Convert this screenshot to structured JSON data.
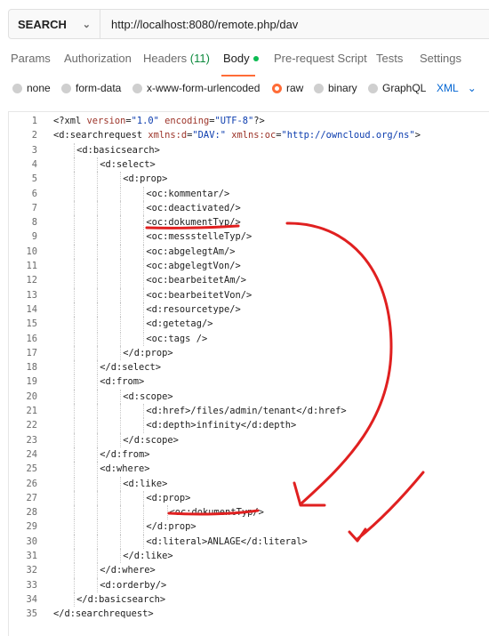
{
  "request": {
    "method": "SEARCH",
    "url": "http://localhost:8080/remote.php/dav"
  },
  "tabs": {
    "params": "Params",
    "authorization": "Authorization",
    "headers": "Headers",
    "headers_count": "(11)",
    "body": "Body",
    "prerequest": "Pre-request Script",
    "tests": "Tests",
    "settings": "Settings"
  },
  "body_types": {
    "none": "none",
    "form_data": "form-data",
    "urlencoded": "x-www-form-urlencoded",
    "raw": "raw",
    "binary": "binary",
    "graphql": "GraphQL",
    "format": "XML"
  },
  "icons": {
    "method_dropdown": "chevron-down-icon",
    "format_dropdown": "chevron-down-icon"
  },
  "colors": {
    "accent": "#ff6c37",
    "active_dot": "#0cbb52",
    "link": "#0265d2",
    "annotation": "#e02020"
  },
  "code": [
    {
      "n": "1",
      "indent": 0,
      "parts": [
        [
          "tag",
          "<?xml "
        ],
        [
          "attr",
          "version"
        ],
        [
          "tag",
          "="
        ],
        [
          "val",
          "\"1.0\""
        ],
        [
          "tag",
          " "
        ],
        [
          "attr",
          "encoding"
        ],
        [
          "tag",
          "="
        ],
        [
          "val",
          "\"UTF-8\""
        ],
        [
          "tag",
          "?>"
        ]
      ]
    },
    {
      "n": "2",
      "indent": 0,
      "parts": [
        [
          "tag",
          "<d:searchrequest "
        ],
        [
          "attr",
          "xmlns:d"
        ],
        [
          "tag",
          "="
        ],
        [
          "val",
          "\"DAV:\""
        ],
        [
          "tag",
          " "
        ],
        [
          "attr",
          "xmlns:oc"
        ],
        [
          "tag",
          "="
        ],
        [
          "val",
          "\"http://owncloud.org/ns\""
        ],
        [
          "tag",
          ">"
        ]
      ]
    },
    {
      "n": "3",
      "indent": 1,
      "parts": [
        [
          "tag",
          "<d:basicsearch>"
        ]
      ]
    },
    {
      "n": "4",
      "indent": 2,
      "parts": [
        [
          "tag",
          "<d:select>"
        ]
      ]
    },
    {
      "n": "5",
      "indent": 3,
      "parts": [
        [
          "tag",
          "<d:prop>"
        ]
      ]
    },
    {
      "n": "6",
      "indent": 4,
      "parts": [
        [
          "tag",
          "<oc:kommentar/>"
        ]
      ]
    },
    {
      "n": "7",
      "indent": 4,
      "parts": [
        [
          "tag",
          "<oc:deactivated/>"
        ]
      ]
    },
    {
      "n": "8",
      "indent": 4,
      "parts": [
        [
          "tag",
          "<oc:dokumentTyp/>"
        ]
      ]
    },
    {
      "n": "9",
      "indent": 4,
      "parts": [
        [
          "tag",
          "<oc:messstelleTyp/>"
        ]
      ]
    },
    {
      "n": "10",
      "indent": 4,
      "parts": [
        [
          "tag",
          "<oc:abgelegtAm/>"
        ]
      ]
    },
    {
      "n": "11",
      "indent": 4,
      "parts": [
        [
          "tag",
          "<oc:abgelegtVon/>"
        ]
      ]
    },
    {
      "n": "12",
      "indent": 4,
      "parts": [
        [
          "tag",
          "<oc:bearbeitetAm/>"
        ]
      ]
    },
    {
      "n": "13",
      "indent": 4,
      "parts": [
        [
          "tag",
          "<oc:bearbeitetVon/>"
        ]
      ]
    },
    {
      "n": "14",
      "indent": 4,
      "parts": [
        [
          "tag",
          "<d:resourcetype/>"
        ]
      ]
    },
    {
      "n": "15",
      "indent": 4,
      "parts": [
        [
          "tag",
          "<d:getetag/>"
        ]
      ]
    },
    {
      "n": "16",
      "indent": 4,
      "parts": [
        [
          "tag",
          "<oc:tags />"
        ]
      ]
    },
    {
      "n": "17",
      "indent": 3,
      "parts": [
        [
          "tag",
          "</d:prop>"
        ]
      ]
    },
    {
      "n": "18",
      "indent": 2,
      "parts": [
        [
          "tag",
          "</d:select>"
        ]
      ]
    },
    {
      "n": "19",
      "indent": 2,
      "parts": [
        [
          "tag",
          "<d:from>"
        ]
      ]
    },
    {
      "n": "20",
      "indent": 3,
      "parts": [
        [
          "tag",
          "<d:scope>"
        ]
      ]
    },
    {
      "n": "21",
      "indent": 4,
      "parts": [
        [
          "tag",
          "<d:href>/files/admin/tenant</d:href>"
        ]
      ]
    },
    {
      "n": "22",
      "indent": 4,
      "parts": [
        [
          "tag",
          "<d:depth>infinity</d:depth>"
        ]
      ]
    },
    {
      "n": "23",
      "indent": 3,
      "parts": [
        [
          "tag",
          "</d:scope>"
        ]
      ]
    },
    {
      "n": "24",
      "indent": 2,
      "parts": [
        [
          "tag",
          "</d:from>"
        ]
      ]
    },
    {
      "n": "25",
      "indent": 2,
      "parts": [
        [
          "tag",
          "<d:where>"
        ]
      ]
    },
    {
      "n": "26",
      "indent": 3,
      "parts": [
        [
          "tag",
          "<d:like>"
        ]
      ]
    },
    {
      "n": "27",
      "indent": 4,
      "parts": [
        [
          "tag",
          "<d:prop>"
        ]
      ]
    },
    {
      "n": "28",
      "indent": 5,
      "parts": [
        [
          "tag",
          "<oc:dokumentTyp/>"
        ]
      ]
    },
    {
      "n": "29",
      "indent": 4,
      "parts": [
        [
          "tag",
          "</d:prop>"
        ]
      ]
    },
    {
      "n": "30",
      "indent": 4,
      "parts": [
        [
          "tag",
          "<d:literal>ANLAGE</d:literal>"
        ]
      ]
    },
    {
      "n": "31",
      "indent": 3,
      "parts": [
        [
          "tag",
          "</d:like>"
        ]
      ]
    },
    {
      "n": "32",
      "indent": 2,
      "parts": [
        [
          "tag",
          "</d:where>"
        ]
      ]
    },
    {
      "n": "33",
      "indent": 2,
      "parts": [
        [
          "tag",
          "<d:orderby/>"
        ]
      ]
    },
    {
      "n": "34",
      "indent": 1,
      "parts": [
        [
          "tag",
          "</d:basicsearch>"
        ]
      ]
    },
    {
      "n": "35",
      "indent": 0,
      "parts": [
        [
          "tag",
          "</d:searchrequest>"
        ]
      ]
    }
  ]
}
